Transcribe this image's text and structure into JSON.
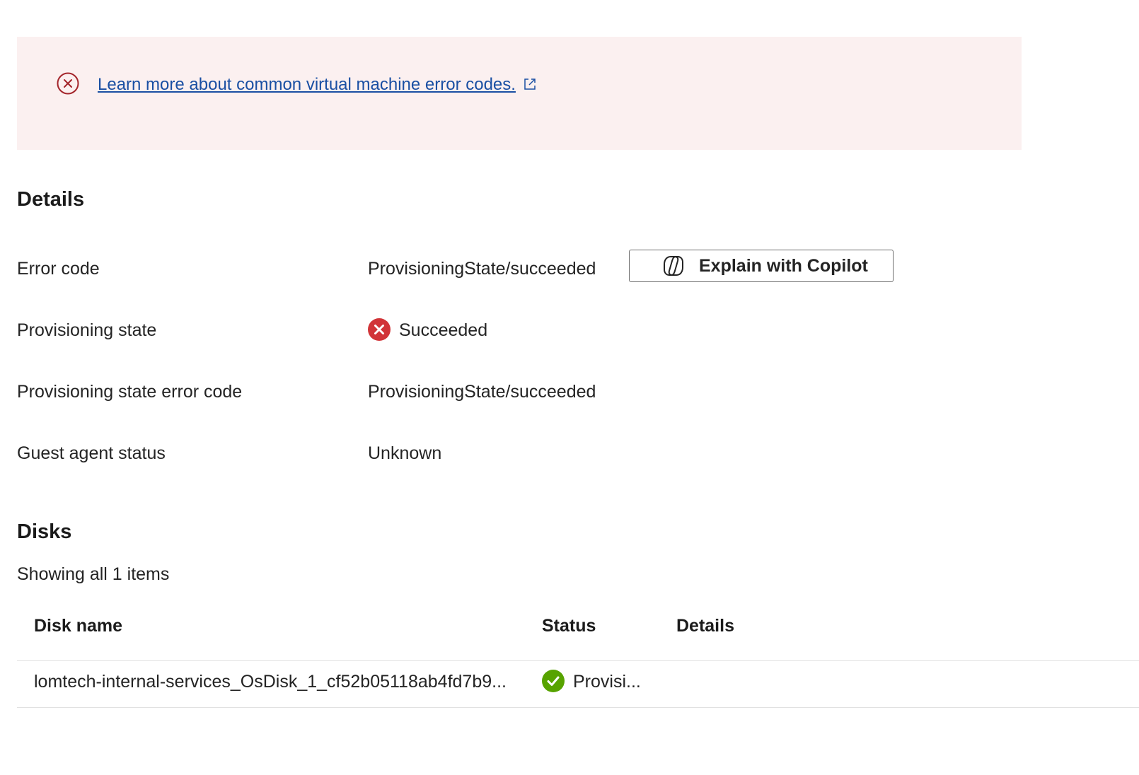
{
  "banner": {
    "link_text": "Learn more about common virtual machine error codes.",
    "error_icon": "circle-x-icon",
    "external_icon": "external-link-icon",
    "color": "#a4262c"
  },
  "details": {
    "title": "Details",
    "rows": [
      {
        "label": "Error code",
        "value": "ProvisioningState/succeeded"
      },
      {
        "label": "Provisioning state",
        "value": "Succeeded",
        "icon": "error-filled-icon"
      },
      {
        "label": "Provisioning state error code",
        "value": "ProvisioningState/succeeded"
      },
      {
        "label": "Guest agent status",
        "value": "Unknown"
      }
    ],
    "copilot_button": {
      "label": "Explain with Copilot",
      "icon": "copilot-icon"
    }
  },
  "disks": {
    "title": "Disks",
    "count_text": "Showing all 1 items",
    "columns": [
      "Disk name",
      "Status",
      "Details"
    ],
    "rows": [
      {
        "disk_name": "lomtech-internal-services_OsDisk_1_cf52b05118ab4fd7b9...",
        "status": "Provisi...",
        "status_icon": "success-check-icon",
        "details": ""
      }
    ]
  },
  "colors": {
    "banner_bg": "#fbf0f0",
    "link": "#1a4fa3",
    "error": "#d13438",
    "success": "#57a300"
  }
}
